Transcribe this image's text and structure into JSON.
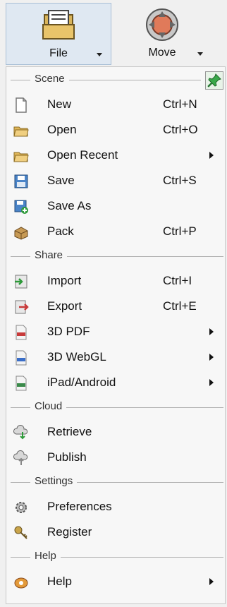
{
  "ribbon": {
    "file_label": "File",
    "move_label": "Move"
  },
  "sections": [
    {
      "label": "Scene",
      "items": [
        {
          "label": "New",
          "shortcut": "Ctrl+N",
          "icon": "new-document-icon"
        },
        {
          "label": "Open",
          "shortcut": "Ctrl+O",
          "icon": "folder-open-icon"
        },
        {
          "label": "Open Recent",
          "shortcut": "",
          "icon": "folder-recent-icon",
          "submenu": true
        },
        {
          "label": "Save",
          "shortcut": "Ctrl+S",
          "icon": "floppy-disk-icon"
        },
        {
          "label": "Save As",
          "shortcut": "",
          "icon": "floppy-disk-plus-icon"
        },
        {
          "label": "Pack",
          "shortcut": "Ctrl+P",
          "icon": "package-icon"
        }
      ]
    },
    {
      "label": "Share",
      "items": [
        {
          "label": "Import",
          "shortcut": "Ctrl+I",
          "icon": "import-icon"
        },
        {
          "label": "Export",
          "shortcut": "Ctrl+E",
          "icon": "export-icon"
        },
        {
          "label": "3D PDF",
          "shortcut": "",
          "icon": "pdf-file-icon",
          "submenu": true
        },
        {
          "label": "3D WebGL",
          "shortcut": "",
          "icon": "html-file-icon",
          "submenu": true
        },
        {
          "label": "iPad/Android",
          "shortcut": "",
          "icon": "mobile-file-icon",
          "submenu": true
        }
      ]
    },
    {
      "label": "Cloud",
      "items": [
        {
          "label": "Retrieve",
          "shortcut": "",
          "icon": "cloud-download-icon"
        },
        {
          "label": "Publish",
          "shortcut": "",
          "icon": "cloud-upload-icon"
        }
      ]
    },
    {
      "label": "Settings",
      "items": [
        {
          "label": "Preferences",
          "shortcut": "",
          "icon": "gear-icon"
        },
        {
          "label": "Register",
          "shortcut": "",
          "icon": "key-icon"
        }
      ]
    },
    {
      "label": "Help",
      "items": [
        {
          "label": "Help",
          "shortcut": "",
          "icon": "help-icon",
          "submenu": true
        }
      ]
    }
  ]
}
